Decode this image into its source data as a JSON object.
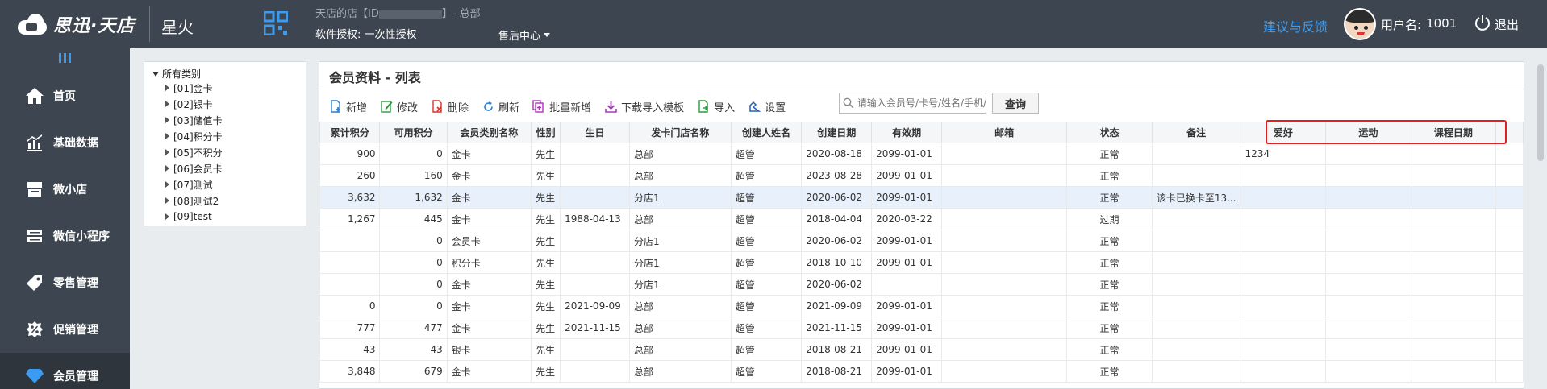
{
  "header": {
    "logo_text": "思迅·天店",
    "product_name": "星火",
    "store_prefix": "天店的店【ID",
    "store_suffix": "】- 总部",
    "license_label": "软件授权:",
    "license_value": "一次性授权",
    "after_sale": "售后中心",
    "feedback": "建议与反馈",
    "username_label": "用户名:",
    "username_value": "1001",
    "logout": "退出"
  },
  "sidebar": {
    "items": [
      {
        "label": "首页",
        "icon": "home-icon"
      },
      {
        "label": "基础数据",
        "icon": "chart-icon"
      },
      {
        "label": "微小店",
        "icon": "shop-icon"
      },
      {
        "label": "微信小程序",
        "icon": "miniapp-icon"
      },
      {
        "label": "零售管理",
        "icon": "tag-icon"
      },
      {
        "label": "促销管理",
        "icon": "percent-icon"
      },
      {
        "label": "会员管理",
        "icon": "diamond-icon"
      }
    ],
    "active_index": 6
  },
  "tree": {
    "root": "所有类别",
    "nodes": [
      "[01]金卡",
      "[02]银卡",
      "[03]储值卡",
      "[04]积分卡",
      "[05]不积分",
      "[06]会员卡",
      "[07]测试",
      "[08]测试2",
      "[09]test"
    ]
  },
  "panel": {
    "title": "会员资料 - 列表"
  },
  "toolbar": {
    "add": "新增",
    "edit": "修改",
    "delete": "删除",
    "refresh": "刷新",
    "batch_add": "批量新增",
    "download_template": "下载导入模板",
    "import": "导入",
    "settings": "设置",
    "search_placeholder": "请输入会员号/卡号/姓名/手机/",
    "query": "查询"
  },
  "table": {
    "columns": [
      "累计积分",
      "可用积分",
      "会员类别名称",
      "性别",
      "生日",
      "发卡门店名称",
      "创建人姓名",
      "创建日期",
      "有效期",
      "邮箱",
      "状态",
      "备注",
      "爱好",
      "运动",
      "课程日期"
    ],
    "rows": [
      [
        "900",
        "0",
        "金卡",
        "先生",
        "",
        "总部",
        "超管",
        "2020-08-18",
        "2099-01-01",
        "",
        "正常",
        "",
        "1234",
        "",
        ""
      ],
      [
        "260",
        "160",
        "金卡",
        "先生",
        "",
        "总部",
        "超管",
        "2023-08-28",
        "2099-01-01",
        "",
        "正常",
        "",
        "",
        "",
        ""
      ],
      [
        "3,632",
        "1,632",
        "金卡",
        "先生",
        "",
        "分店1",
        "超管",
        "2020-06-02",
        "2099-01-01",
        "",
        "正常",
        "该卡已换卡至13...",
        "",
        "",
        ""
      ],
      [
        "1,267",
        "445",
        "金卡",
        "先生",
        "1988-04-13",
        "总部",
        "超管",
        "2018-04-04",
        "2020-03-22",
        "",
        "过期",
        "",
        "",
        "",
        ""
      ],
      [
        "",
        "0",
        "会员卡",
        "先生",
        "",
        "分店1",
        "超管",
        "2020-06-02",
        "2099-01-01",
        "",
        "正常",
        "",
        "",
        "",
        ""
      ],
      [
        "",
        "0",
        "积分卡",
        "先生",
        "",
        "分店1",
        "超管",
        "2018-10-10",
        "2099-01-01",
        "",
        "正常",
        "",
        "",
        "",
        ""
      ],
      [
        "",
        "0",
        "金卡",
        "先生",
        "",
        "分店1",
        "超管",
        "2020-06-02",
        "",
        "",
        "正常",
        "",
        "",
        "",
        ""
      ],
      [
        "0",
        "0",
        "金卡",
        "先生",
        "2021-09-09",
        "总部",
        "超管",
        "2021-09-09",
        "2099-01-01",
        "",
        "正常",
        "",
        "",
        "",
        ""
      ],
      [
        "777",
        "477",
        "金卡",
        "先生",
        "2021-11-15",
        "总部",
        "超管",
        "2021-11-15",
        "2099-01-01",
        "",
        "正常",
        "",
        "",
        "",
        ""
      ],
      [
        "43",
        "43",
        "银卡",
        "先生",
        "",
        "总部",
        "超管",
        "2018-08-21",
        "2099-01-01",
        "",
        "正常",
        "",
        "",
        "",
        ""
      ],
      [
        "3,848",
        "679",
        "金卡",
        "先生",
        "",
        "总部",
        "超管",
        "2018-08-21",
        "2099-01-01",
        "",
        "正常",
        "",
        "",
        "",
        ""
      ]
    ],
    "selected_row": 2
  },
  "colors": {
    "header_bg": "#3d4650",
    "accent": "#3a9bf0",
    "highlight": "#e02020"
  }
}
